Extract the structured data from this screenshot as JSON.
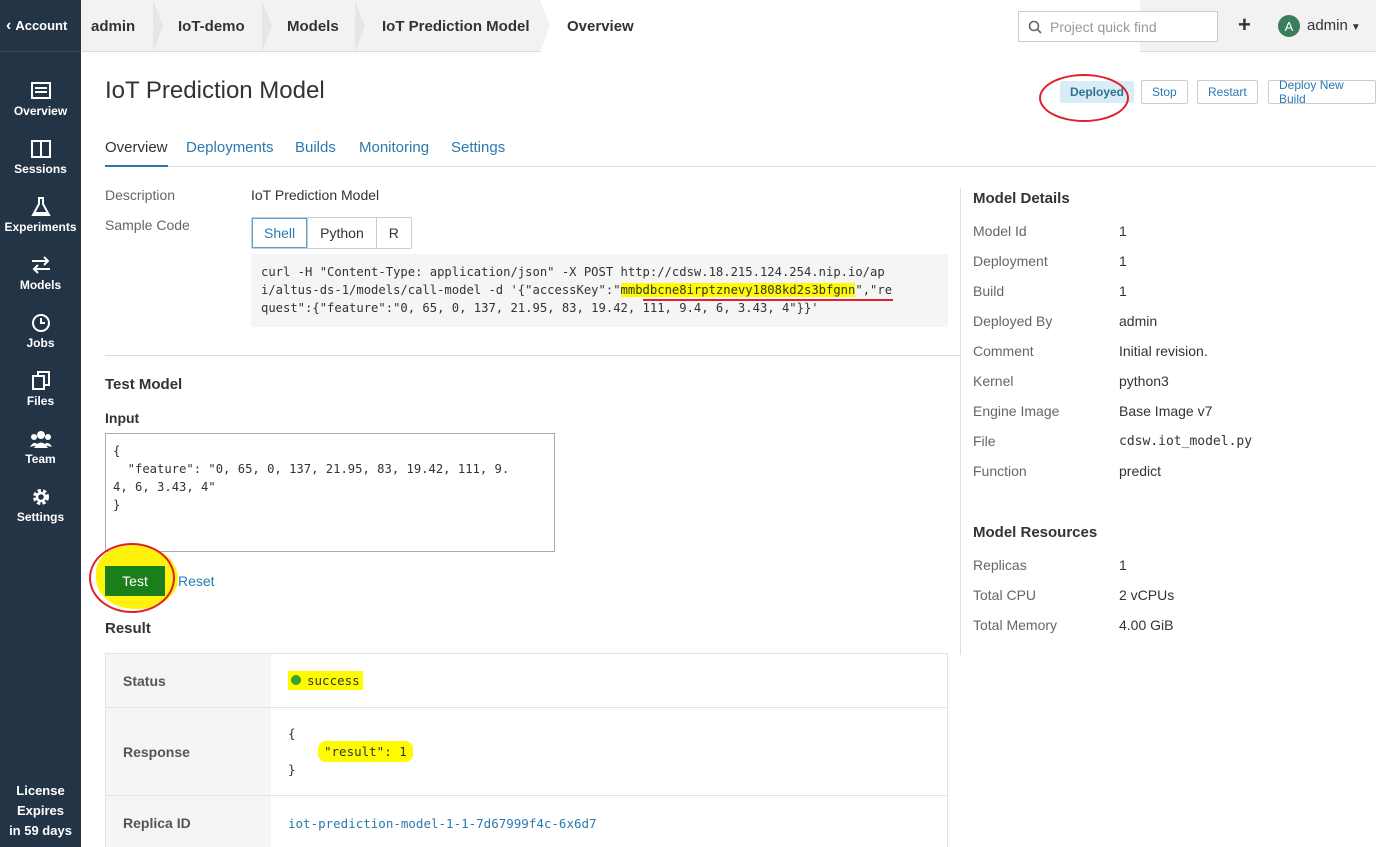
{
  "sidebar": {
    "account_label": "Account",
    "items": [
      {
        "label": "Overview",
        "icon": "overview-icon"
      },
      {
        "label": "Sessions",
        "icon": "sessions-icon"
      },
      {
        "label": "Experiments",
        "icon": "flask-icon"
      },
      {
        "label": "Models",
        "icon": "swap-arrows-icon"
      },
      {
        "label": "Jobs",
        "icon": "clock-icon"
      },
      {
        "label": "Files",
        "icon": "files-icon"
      },
      {
        "label": "Team",
        "icon": "team-icon"
      },
      {
        "label": "Settings",
        "icon": "gear-icon"
      }
    ],
    "license": [
      "License",
      "Expires",
      "in 59 days"
    ]
  },
  "breadcrumb": [
    "admin",
    "IoT-demo",
    "Models",
    "IoT Prediction Model",
    "Overview"
  ],
  "search": {
    "placeholder": "Project quick find"
  },
  "user": {
    "initial": "A",
    "name": "admin"
  },
  "page": {
    "title": "IoT Prediction Model",
    "status": "Deployed",
    "actions": [
      "Stop",
      "Restart",
      "Deploy New Build"
    ]
  },
  "tabs": [
    "Overview",
    "Deployments",
    "Builds",
    "Monitoring",
    "Settings"
  ],
  "description": {
    "label": "Description",
    "value": "IoT Prediction Model"
  },
  "sample_code": {
    "label": "Sample Code",
    "languages": [
      "Shell",
      "Python",
      "R"
    ],
    "selected": "Shell",
    "line1": "curl -H \"Content-Type: application/json\" -X POST http://cdsw.18.215.124.254.nip.io/ap",
    "line2_pre": "i/altus-ds-1/models/call-model -d '{\"accessKey\":\"",
    "access_key": "mmbdbcne8irptznevy1808kd2s3bfgnn",
    "line2_post": "\",\"re",
    "line3": "quest\":{\"feature\":\"0, 65, 0, 137, 21.95, 83, 19.42, 111, 9.4, 6, 3.43, 4\"}}'"
  },
  "test_model": {
    "title": "Test Model",
    "input_label": "Input",
    "input_value": "{\n  \"feature\": \"0, 65, 0, 137, 21.95, 83, 19.42, 111, 9.\n4, 6, 3.43, 4\"\n}",
    "test_label": "Test",
    "reset_label": "Reset"
  },
  "result": {
    "title": "Result",
    "status_label": "Status",
    "status_value": "success",
    "response_label": "Response",
    "response_open": "{",
    "response_line": "\"result\": 1",
    "response_close": "}",
    "replica_label": "Replica ID",
    "replica_value": "iot-prediction-model-1-1-7d67999f4c-6x6d7"
  },
  "model_details": {
    "title": "Model Details",
    "rows": [
      {
        "label": "Model Id",
        "value": "1"
      },
      {
        "label": "Deployment",
        "value": "1"
      },
      {
        "label": "Build",
        "value": "1"
      },
      {
        "label": "Deployed By",
        "value": "admin"
      },
      {
        "label": "Comment",
        "value": "Initial revision."
      },
      {
        "label": "Kernel",
        "value": "python3"
      },
      {
        "label": "Engine Image",
        "value": "Base Image v7"
      },
      {
        "label": "File",
        "value": "cdsw.iot_model.py"
      },
      {
        "label": "Function",
        "value": "predict"
      }
    ]
  },
  "model_resources": {
    "title": "Model Resources",
    "rows": [
      {
        "label": "Replicas",
        "value": "1"
      },
      {
        "label": "Total CPU",
        "value": "2 vCPUs"
      },
      {
        "label": "Total Memory",
        "value": "4.00 GiB"
      }
    ]
  },
  "colors": {
    "sidebar": "#243447",
    "link": "#2a7ab0",
    "test_button": "#1a7f1a",
    "highlight": "#fffb00",
    "annotation": "#e0202a"
  }
}
